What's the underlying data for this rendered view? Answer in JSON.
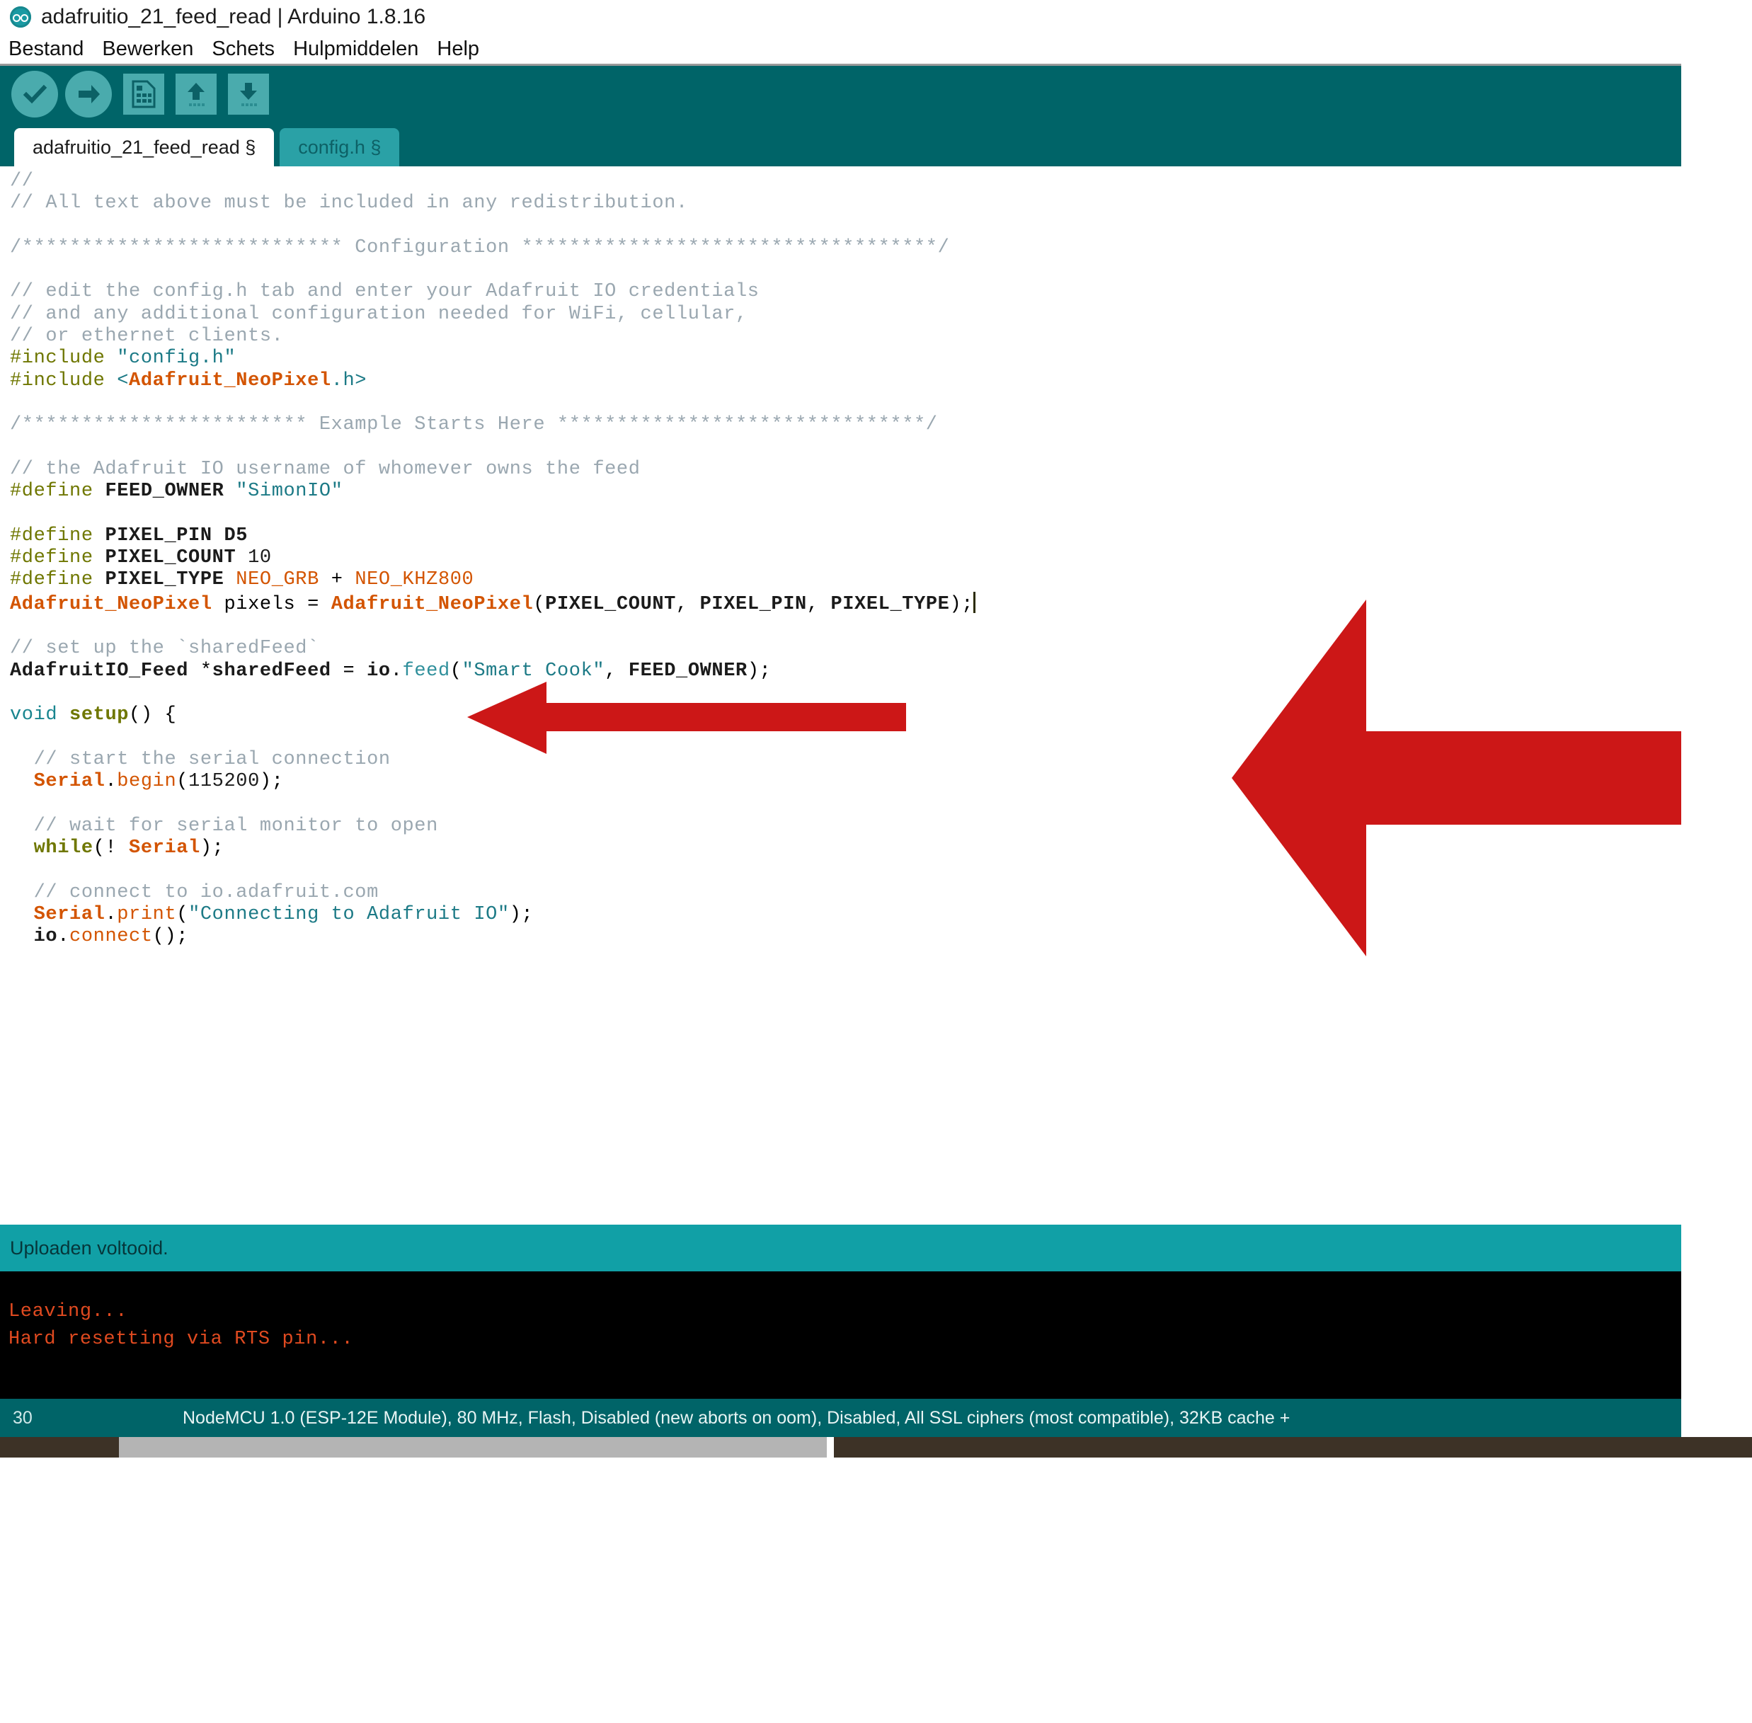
{
  "window": {
    "title": "adafruitio_21_feed_read | Arduino 1.8.16",
    "app_icon": "arduino-infinity-icon"
  },
  "menubar": {
    "items": [
      {
        "label": "Bestand",
        "name": "menu-bestand"
      },
      {
        "label": "Bewerken",
        "name": "menu-bewerken"
      },
      {
        "label": "Schets",
        "name": "menu-schets"
      },
      {
        "label": "Hulpmiddelen",
        "name": "menu-hulpmiddelen"
      },
      {
        "label": "Help",
        "name": "menu-help"
      }
    ]
  },
  "toolbar": {
    "buttons": [
      {
        "name": "verify-button",
        "icon": "check-icon",
        "tooltip": "Verify"
      },
      {
        "name": "upload-button",
        "icon": "right-arrow-icon",
        "tooltip": "Upload"
      },
      {
        "name": "new-button",
        "icon": "document-icon",
        "tooltip": "New"
      },
      {
        "name": "open-button",
        "icon": "up-arrow-icon",
        "tooltip": "Open"
      },
      {
        "name": "save-button",
        "icon": "down-arrow-icon",
        "tooltip": "Save"
      }
    ]
  },
  "tabs": [
    {
      "label": "adafruitio_21_feed_read §",
      "active": true
    },
    {
      "label": "config.h §",
      "active": false
    }
  ],
  "editor": {
    "lines": [
      "//",
      "// All text above must be included in any redistribution.",
      "",
      "/*************************** Configuration ***********************************/",
      "",
      "// edit the config.h tab and enter your Adafruit IO credentials",
      "// and any additional configuration needed for WiFi, cellular,",
      "// or ethernet clients.",
      "#include \"config.h\"",
      "#include <Adafruit_NeoPixel.h>",
      "",
      "/************************ Example Starts Here *******************************/",
      "",
      "// the Adafruit IO username of whomever owns the feed",
      "#define FEED_OWNER \"SimonIO\"",
      "",
      "#define PIXEL_PIN D5",
      "#define PIXEL_COUNT 10",
      "#define PIXEL_TYPE NEO_GRB + NEO_KHZ800",
      "Adafruit_NeoPixel pixels = Adafruit_NeoPixel(PIXEL_COUNT, PIXEL_PIN, PIXEL_TYPE);",
      "",
      "// set up the `sharedFeed`",
      "AdafruitIO_Feed *sharedFeed = io.feed(\"Smart Cook\", FEED_OWNER);",
      "",
      "void setup() {",
      "",
      "  // start the serial connection",
      "  Serial.begin(115200);",
      "",
      "  // wait for serial monitor to open",
      "  while(! Serial);",
      "",
      "  // connect to io.adafruit.com",
      "  Serial.print(\"Connecting to Adafruit IO\");",
      "  io.connect();"
    ],
    "cursor_line": "Adafruit_NeoPixel pixels = Adafruit_NeoPixel(PIXEL_COUNT, PIXEL_PIN, PIXEL_TYPE);"
  },
  "annotations": {
    "arrow_color": "#cc1717",
    "arrow_small_target": "#include <Adafruit_NeoPixel.h>",
    "arrow_large_target": "Adafruit_NeoPixel pixels = Adafruit_NeoPixel(PIXEL_COUNT, PIXEL_PIN, PIXEL_TYPE);"
  },
  "status": {
    "message": "Uploaden voltooid."
  },
  "console": {
    "lines": [
      "Leaving...",
      "Hard resetting via RTS pin..."
    ]
  },
  "bottombar": {
    "line_number": "30",
    "board_info": "NodeMCU 1.0 (ESP-12E Module), 80 MHz, Flash, Disabled (new aborts on oom), Disabled, All SSL ciphers (most compatible), 32KB cache +",
    "plus": "+"
  },
  "colors": {
    "teal_dark": "#006468",
    "teal_mid": "#2aa1a6",
    "teal_status": "#11a0a6",
    "console_bg": "#000000",
    "console_text": "#e04a20",
    "annotation_red": "#cc1717"
  }
}
